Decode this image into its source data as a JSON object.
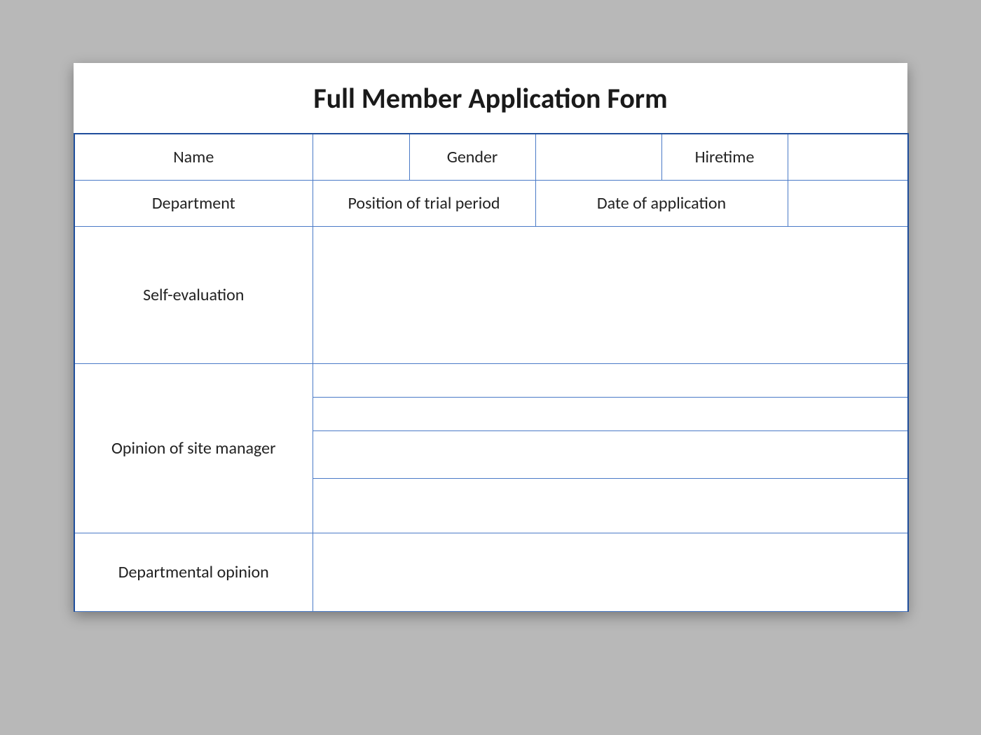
{
  "title": "Full Member Application Form",
  "row1": {
    "name": "Name",
    "gender": "Gender",
    "hiretime": "Hiretime"
  },
  "row2": {
    "department": "Department",
    "trial": "Position of trial period",
    "appdate": "Date of application"
  },
  "rows": {
    "selfEval": "Self-evaluation",
    "siteMgr": "Opinion of site manager",
    "deptOpinion": "Departmental opinion"
  },
  "values": {
    "name": "",
    "gender": "",
    "hiretime": "",
    "department": "",
    "trial": "",
    "appdate": "",
    "selfEval": "",
    "op1": "",
    "op2": "",
    "op3": "",
    "op4": "",
    "deptOpinion": ""
  }
}
